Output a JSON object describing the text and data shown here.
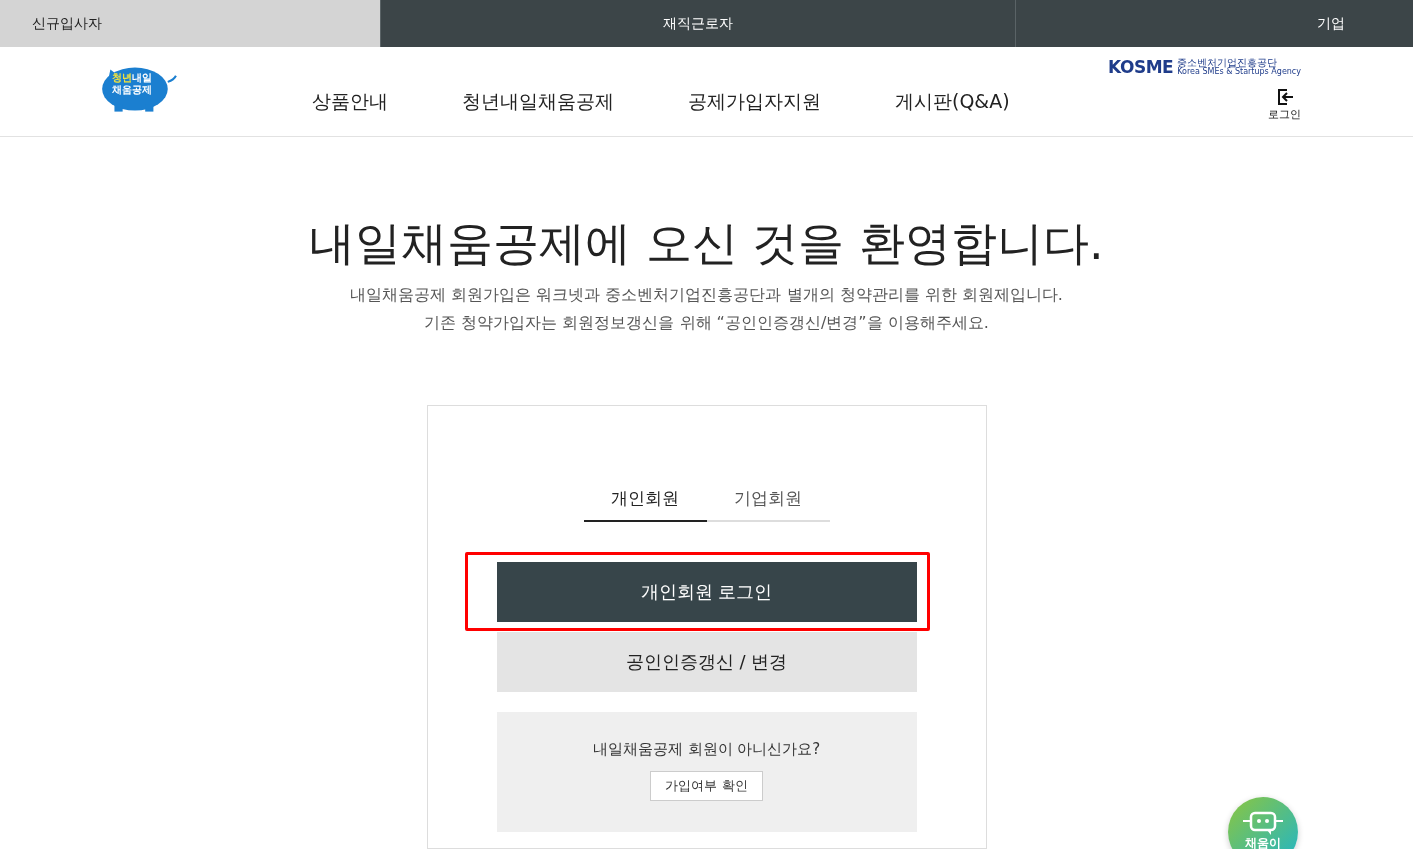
{
  "top_tabs": [
    {
      "label": "신규입사자",
      "selected": true
    },
    {
      "label": "재직근로자",
      "selected": false
    },
    {
      "label": "기업",
      "selected": false
    }
  ],
  "header": {
    "logo": {
      "line_1_a": "청년",
      "line_1_b": "내일",
      "line_2": "채움공제"
    },
    "nav": [
      "상품안내",
      "청년내일채움공제",
      "공제가입자지원",
      "게시판(Q&A)"
    ],
    "agency": {
      "mark": "KOSME",
      "name": "중소벤처기업진흥공단",
      "name_en": "Korea SMEs & Startups Agency"
    },
    "login_label": "로그인"
  },
  "welcome": {
    "title": "내일채움공제에 오신 것을 환영합니다.",
    "lines": [
      "내일채움공제 회원가입은 워크넷과 중소벤처기업진흥공단과 별개의 청약관리를 위한 회원제입니다.",
      "기존 청약가입자는 회원정보갱신을 위해 “공인인증갱신/변경”을 이용해주세요."
    ]
  },
  "login_card": {
    "tabs": [
      {
        "label": "개인회원",
        "selected": true
      },
      {
        "label": "기업회원",
        "selected": false
      }
    ],
    "login_button": {
      "label": "개인회원 로그인",
      "highlighted": true
    },
    "cert_button": "공인인증갱신 / 변경",
    "notice": {
      "question": "내일채움공제 회원이 아니신가요?",
      "button": "가입여부 확인"
    }
  },
  "chatbot": {
    "label": "채움이"
  }
}
